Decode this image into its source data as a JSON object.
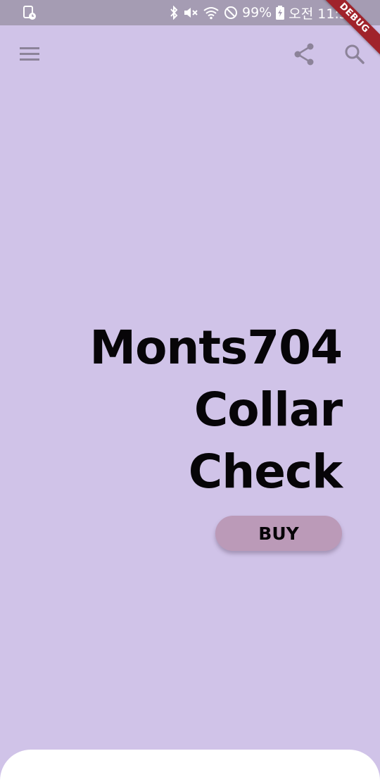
{
  "status_bar": {
    "battery": "99%",
    "time": "오전 11:50",
    "icons": [
      "screenshot-icon",
      "bluetooth-icon",
      "mute-icon",
      "wifi-icon",
      "do-not-disturb-icon",
      "battery-charging-icon"
    ]
  },
  "debug_banner": "DEBUG",
  "app_bar": {
    "icons": [
      "menu-icon",
      "share-icon",
      "search-icon"
    ]
  },
  "product": {
    "title_lines": [
      "Monts704",
      "Collar",
      "Check"
    ],
    "buy_label": "BUY"
  },
  "colors": {
    "background": "#d0c3e8",
    "status_bar": "#a59cb3",
    "buy_button": "#bb9ab8",
    "title_text": "#070508",
    "bottom_sheet": "#ffffff",
    "debug_ribbon": "#a0232b"
  }
}
